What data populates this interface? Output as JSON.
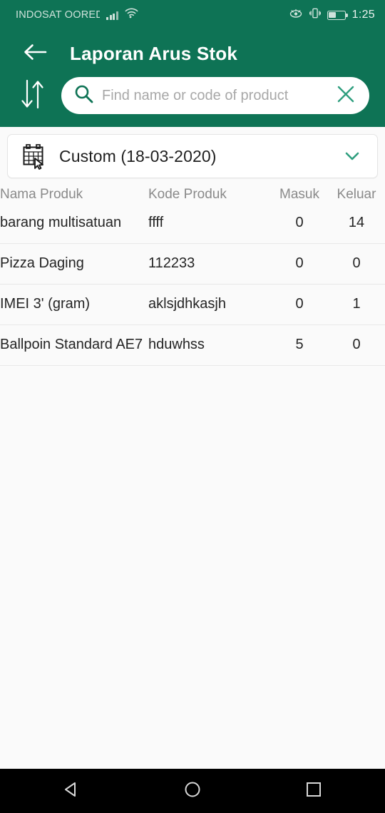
{
  "statusbar": {
    "carrier": "INDOSAT OORED",
    "time": "1:25",
    "icons": [
      "signal-icon",
      "wifi-icon",
      "eye-icon",
      "vibrate-icon",
      "battery-icon"
    ]
  },
  "appbar": {
    "back_icon": "back-arrow-icon",
    "title": "Laporan Arus Stok",
    "sort_icon": "sort-arrows-icon",
    "background_color": "#0E7355"
  },
  "search": {
    "placeholder": "Find name or code of product",
    "value": "",
    "search_icon": "search-icon",
    "clear_icon": "close-icon",
    "accent_color": "#2E9E7E"
  },
  "date_filter": {
    "label": "Custom (18-03-2020)",
    "calendar_icon": "calendar-cursor-icon",
    "chevron_icon": "chevron-down-icon"
  },
  "table": {
    "headers": {
      "name": "Nama Produk",
      "code": "Kode Produk",
      "in": "Masuk",
      "out": "Keluar"
    },
    "rows": [
      {
        "name": "barang multisatuan",
        "code": "ffff",
        "in": "0",
        "out": "14"
      },
      {
        "name": "Pizza Daging",
        "code": "112233",
        "in": "0",
        "out": "0"
      },
      {
        "name": "IMEI 3' (gram)",
        "code": "aklsjdhkasjh",
        "in": "0",
        "out": "1"
      },
      {
        "name": "Ballpoin Standard AE7",
        "code": "hduwhss",
        "in": "5",
        "out": "0"
      }
    ]
  },
  "navbar": {
    "back": "nav-back-icon",
    "home": "nav-home-icon",
    "recents": "nav-recents-icon"
  }
}
